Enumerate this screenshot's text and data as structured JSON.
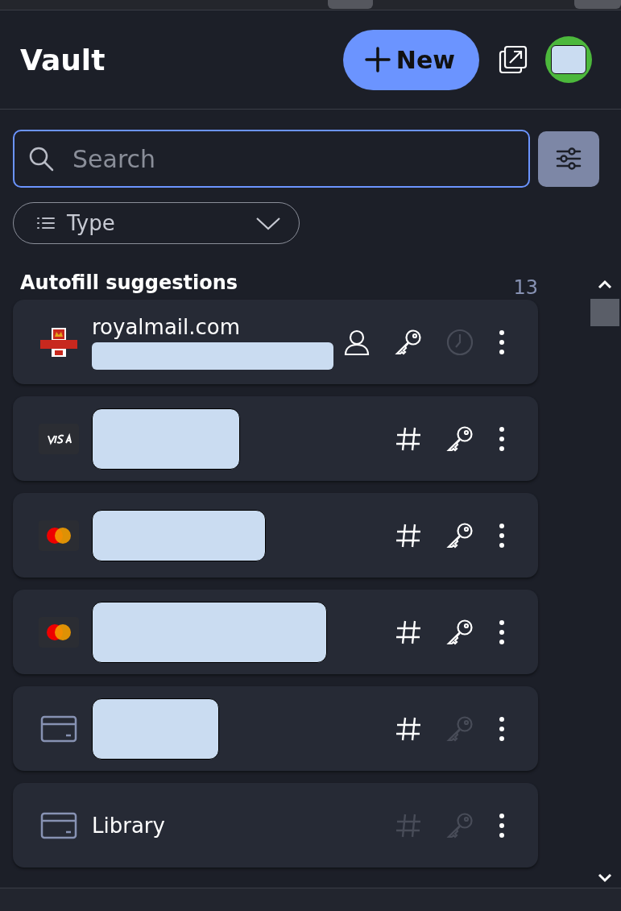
{
  "header": {
    "title": "Vault",
    "new_button": "New"
  },
  "search": {
    "placeholder": "Search"
  },
  "type_filter": {
    "label": "Type"
  },
  "section": {
    "title": "Autofill suggestions",
    "count": "13"
  },
  "items": [
    {
      "kind": "mail",
      "title": "royalmail.com",
      "redacted": true,
      "actions": [
        {
          "kind": "person",
          "disabled": false
        },
        {
          "kind": "key",
          "disabled": false
        },
        {
          "kind": "clock",
          "disabled": true
        }
      ]
    },
    {
      "kind": "visa",
      "redacted": true,
      "actions": [
        {
          "kind": "hash",
          "disabled": false
        },
        {
          "kind": "key",
          "disabled": false
        }
      ]
    },
    {
      "kind": "mastercard",
      "redacted": true,
      "actions": [
        {
          "kind": "hash",
          "disabled": false
        },
        {
          "kind": "key",
          "disabled": false
        }
      ]
    },
    {
      "kind": "mastercard",
      "redacted": true,
      "actions": [
        {
          "kind": "hash",
          "disabled": false
        },
        {
          "kind": "key",
          "disabled": false
        }
      ]
    },
    {
      "kind": "card",
      "redacted": true,
      "actions": [
        {
          "kind": "hash",
          "disabled": false
        },
        {
          "kind": "key",
          "disabled": true
        }
      ]
    },
    {
      "kind": "card",
      "title": "Library",
      "redacted": false,
      "actions": [
        {
          "kind": "hash",
          "disabled": true
        },
        {
          "kind": "key",
          "disabled": true
        }
      ]
    }
  ]
}
